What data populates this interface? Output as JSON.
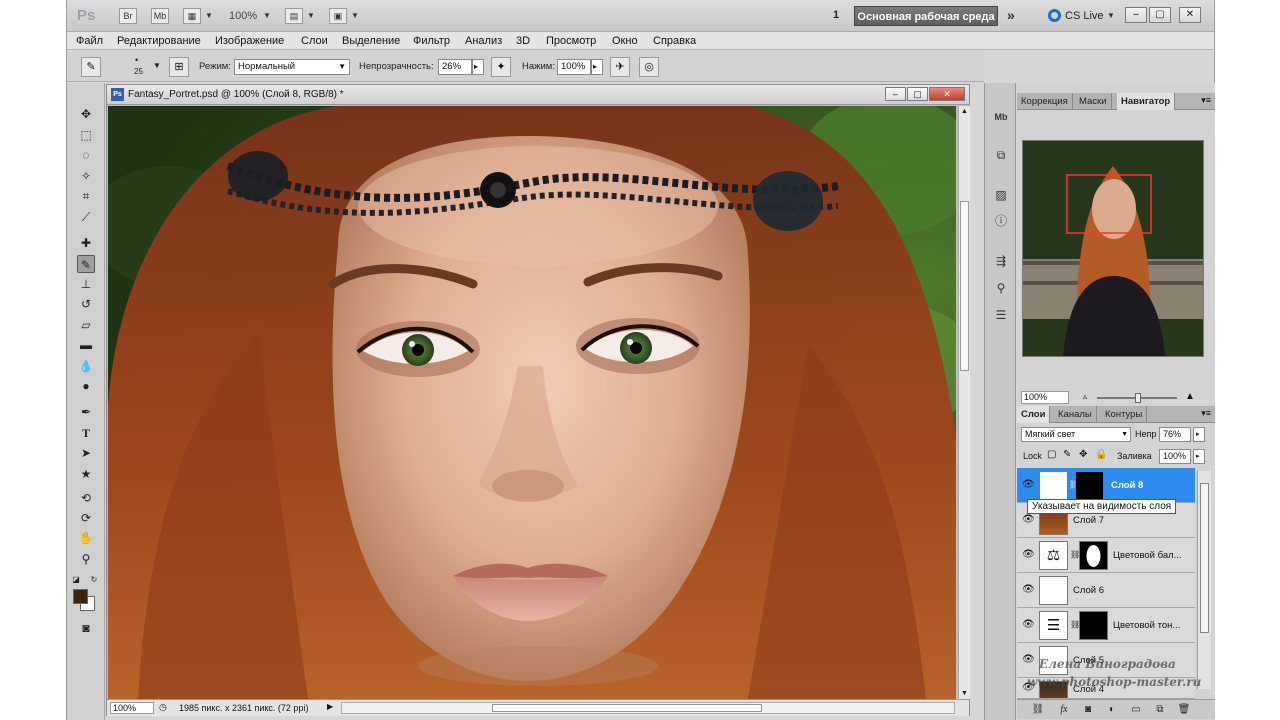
{
  "app": {
    "logo": "Ps",
    "bridge_btn": "Br",
    "minibridge_btn": "Mb",
    "zoom": "100%",
    "workspace_num": "1",
    "workspace": "Основная рабочая среда",
    "cslive": "CS Live",
    "window_min": "–",
    "window_max": "▢",
    "window_close": "✕"
  },
  "menu": [
    "Файл",
    "Редактирование",
    "Изображение",
    "Слои",
    "Выделение",
    "Фильтр",
    "Анализ",
    "3D",
    "Просмотр",
    "Окно",
    "Справка"
  ],
  "options": {
    "brush_size": "25",
    "mode_label": "Режим:",
    "mode_value": "Нормальный",
    "opacity_label": "Непрозрачность:",
    "opacity_value": "26%",
    "flow_label": "Нажим:",
    "flow_value": "100%"
  },
  "document": {
    "ps_badge": "Ps",
    "title": "Fantasy_Portret.psd @ 100% (Слой 8, RGB/8) *",
    "zoom_field": "100%",
    "info": "1985 пикс. x 2361 пикс. (72 ppi)"
  },
  "top_panel": {
    "tabs": [
      "Коррекция",
      "Маски",
      "Навигатор"
    ],
    "active_tab": "Навигатор",
    "nav_zoom": "100%"
  },
  "layers_panel": {
    "tabs": [
      "Слои",
      "Каналы",
      "Контуры"
    ],
    "blend_mode": "Мягкий свет",
    "opacity_label": "Непр",
    "opacity_value": "76%",
    "lock_label": "Lock",
    "fill_label": "Заливка",
    "fill_value": "100%",
    "tooltip": "Указывает на видимость слоя",
    "layers": [
      {
        "name": "Слой 8",
        "selected": true
      },
      {
        "name": "Слой 7",
        "selected": false
      },
      {
        "name": "Цветовой бал...",
        "selected": false
      },
      {
        "name": "Слой 6",
        "selected": false
      },
      {
        "name": "Цветовой тон...",
        "selected": false
      },
      {
        "name": "Слой 5",
        "selected": false
      },
      {
        "name": "Слой 4",
        "selected": false
      }
    ]
  },
  "watermark": {
    "line1": "Елена Виноградова",
    "line2": "www.photoshop-master.ru"
  },
  "colors": {
    "accent_selected": "#2d8cf0",
    "foreground": "#3b2512",
    "background": "#ffffff"
  }
}
